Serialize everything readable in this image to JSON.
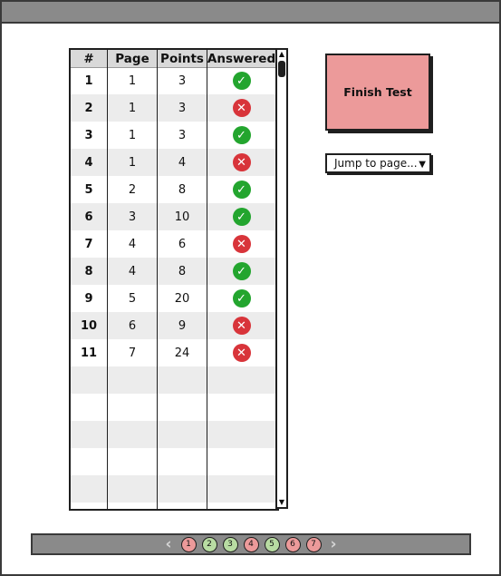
{
  "table": {
    "columns": [
      "#",
      "Page",
      "Points",
      "Answered"
    ],
    "rows": [
      {
        "num": "1",
        "page": "1",
        "points": "3",
        "answered": true
      },
      {
        "num": "2",
        "page": "1",
        "points": "3",
        "answered": false
      },
      {
        "num": "3",
        "page": "1",
        "points": "3",
        "answered": true
      },
      {
        "num": "4",
        "page": "1",
        "points": "4",
        "answered": false
      },
      {
        "num": "5",
        "page": "2",
        "points": "8",
        "answered": true
      },
      {
        "num": "6",
        "page": "3",
        "points": "10",
        "answered": true
      },
      {
        "num": "7",
        "page": "4",
        "points": "6",
        "answered": false
      },
      {
        "num": "8",
        "page": "4",
        "points": "8",
        "answered": true
      },
      {
        "num": "9",
        "page": "5",
        "points": "20",
        "answered": true
      },
      {
        "num": "10",
        "page": "6",
        "points": "9",
        "answered": false
      },
      {
        "num": "11",
        "page": "7",
        "points": "24",
        "answered": false
      }
    ],
    "empty_rows": 5,
    "icons": {
      "answered_yes": "check-circle-icon",
      "answered_no": "x-circle-icon"
    }
  },
  "actions": {
    "finish_label": "Finish Test",
    "jump_label": "Jump to page..."
  },
  "pager": {
    "prev_icon": "chevron-left-icon",
    "next_icon": "chevron-right-icon",
    "pages": [
      {
        "label": "1",
        "state": "unanswered"
      },
      {
        "label": "2",
        "state": "answered"
      },
      {
        "label": "3",
        "state": "answered"
      },
      {
        "label": "4",
        "state": "unanswered"
      },
      {
        "label": "5",
        "state": "answered"
      },
      {
        "label": "6",
        "state": "unanswered"
      },
      {
        "label": "7",
        "state": "unanswered"
      }
    ]
  },
  "colors": {
    "answered": "#23a52e",
    "unanswered": "#d8343a",
    "finish_button": "#ec9a9a",
    "page_answered": "#b8dca2",
    "page_unanswered": "#ec9a9a"
  }
}
